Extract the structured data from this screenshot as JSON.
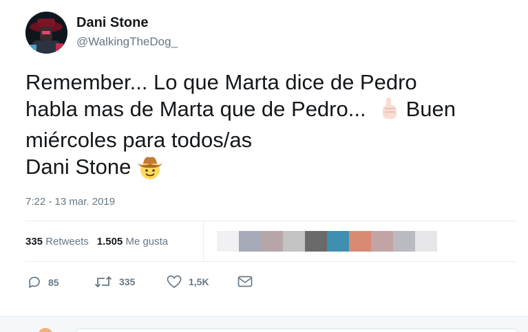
{
  "user": {
    "display_name": "Dani Stone",
    "handle": "@WalkingTheDog_",
    "avatar_icon": "avatar-photo"
  },
  "tweet": {
    "lines": [
      "Remember... Lo que Marta dice de Pedro",
      "habla mas de Marta que de Pedro...",
      "Buen",
      "miércoles para todos/as",
      "Dani Stone"
    ],
    "emojis": [
      "pointing-up-icon",
      "cowboy-face-icon"
    ],
    "timestamp": "7:22 - 13 mar. 2019"
  },
  "stats": {
    "retweets_count": "335",
    "retweets_label": "Retweets",
    "likes_count": "1.505",
    "likes_label": "Me gusta"
  },
  "actions": {
    "reply_count": "85",
    "retweet_count": "335",
    "like_count": "1,5K"
  },
  "colors": {
    "text": "#14171a",
    "secondary": "#657786",
    "divider": "#e6ecf0"
  }
}
